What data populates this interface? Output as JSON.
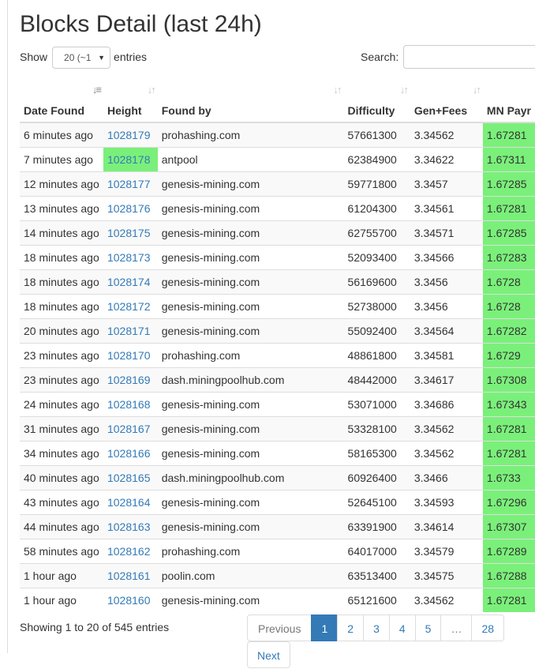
{
  "title": "Blocks Detail (last 24h)",
  "length": {
    "show_label": "Show",
    "selected": "20 (~1",
    "entries_label": "entries"
  },
  "search": {
    "label": "Search:",
    "value": ""
  },
  "columns": [
    "Date Found",
    "Height",
    "Found by",
    "Difficulty",
    "Gen+Fees",
    "MN Payr"
  ],
  "highlight_color": "#7af07a",
  "link_color": "#337ab7",
  "rows": [
    {
      "date": "6 minutes ago",
      "height": "1028179",
      "found_by": "prohashing.com",
      "difficulty": "57661300",
      "gen_fees": "3.34562",
      "mn": "1.67281",
      "height_highlight": false
    },
    {
      "date": "7 minutes ago",
      "height": "1028178",
      "found_by": "antpool",
      "difficulty": "62384900",
      "gen_fees": "3.34622",
      "mn": "1.67311",
      "height_highlight": true
    },
    {
      "date": "12 minutes ago",
      "height": "1028177",
      "found_by": "genesis-mining.com",
      "difficulty": "59771800",
      "gen_fees": "3.3457",
      "mn": "1.67285",
      "height_highlight": false
    },
    {
      "date": "13 minutes ago",
      "height": "1028176",
      "found_by": "genesis-mining.com",
      "difficulty": "61204300",
      "gen_fees": "3.34561",
      "mn": "1.67281",
      "height_highlight": false
    },
    {
      "date": "14 minutes ago",
      "height": "1028175",
      "found_by": "genesis-mining.com",
      "difficulty": "62755700",
      "gen_fees": "3.34571",
      "mn": "1.67285",
      "height_highlight": false
    },
    {
      "date": "18 minutes ago",
      "height": "1028173",
      "found_by": "genesis-mining.com",
      "difficulty": "52093400",
      "gen_fees": "3.34566",
      "mn": "1.67283",
      "height_highlight": false
    },
    {
      "date": "18 minutes ago",
      "height": "1028174",
      "found_by": "genesis-mining.com",
      "difficulty": "56169600",
      "gen_fees": "3.3456",
      "mn": "1.6728",
      "height_highlight": false
    },
    {
      "date": "18 minutes ago",
      "height": "1028172",
      "found_by": "genesis-mining.com",
      "difficulty": "52738000",
      "gen_fees": "3.3456",
      "mn": "1.6728",
      "height_highlight": false
    },
    {
      "date": "20 minutes ago",
      "height": "1028171",
      "found_by": "genesis-mining.com",
      "difficulty": "55092400",
      "gen_fees": "3.34564",
      "mn": "1.67282",
      "height_highlight": false
    },
    {
      "date": "23 minutes ago",
      "height": "1028170",
      "found_by": "prohashing.com",
      "difficulty": "48861800",
      "gen_fees": "3.34581",
      "mn": "1.6729",
      "height_highlight": false
    },
    {
      "date": "23 minutes ago",
      "height": "1028169",
      "found_by": "dash.miningpoolhub.com",
      "difficulty": "48442000",
      "gen_fees": "3.34617",
      "mn": "1.67308",
      "height_highlight": false
    },
    {
      "date": "24 minutes ago",
      "height": "1028168",
      "found_by": "genesis-mining.com",
      "difficulty": "53071000",
      "gen_fees": "3.34686",
      "mn": "1.67343",
      "height_highlight": false
    },
    {
      "date": "31 minutes ago",
      "height": "1028167",
      "found_by": "genesis-mining.com",
      "difficulty": "53328100",
      "gen_fees": "3.34562",
      "mn": "1.67281",
      "height_highlight": false
    },
    {
      "date": "34 minutes ago",
      "height": "1028166",
      "found_by": "genesis-mining.com",
      "difficulty": "58165300",
      "gen_fees": "3.34562",
      "mn": "1.67281",
      "height_highlight": false
    },
    {
      "date": "40 minutes ago",
      "height": "1028165",
      "found_by": "dash.miningpoolhub.com",
      "difficulty": "60926400",
      "gen_fees": "3.3466",
      "mn": "1.6733",
      "height_highlight": false
    },
    {
      "date": "43 minutes ago",
      "height": "1028164",
      "found_by": "genesis-mining.com",
      "difficulty": "52645100",
      "gen_fees": "3.34593",
      "mn": "1.67296",
      "height_highlight": false
    },
    {
      "date": "44 minutes ago",
      "height": "1028163",
      "found_by": "genesis-mining.com",
      "difficulty": "63391900",
      "gen_fees": "3.34614",
      "mn": "1.67307",
      "height_highlight": false
    },
    {
      "date": "58 minutes ago",
      "height": "1028162",
      "found_by": "prohashing.com",
      "difficulty": "64017000",
      "gen_fees": "3.34579",
      "mn": "1.67289",
      "height_highlight": false
    },
    {
      "date": "1 hour ago",
      "height": "1028161",
      "found_by": "poolin.com",
      "difficulty": "63513400",
      "gen_fees": "3.34575",
      "mn": "1.67288",
      "height_highlight": false
    },
    {
      "date": "1 hour ago",
      "height": "1028160",
      "found_by": "genesis-mining.com",
      "difficulty": "65121600",
      "gen_fees": "3.34562",
      "mn": "1.67281",
      "height_highlight": false
    }
  ],
  "info": "Showing 1 to 20 of 545 entries",
  "pagination": {
    "previous": "Previous",
    "pages": [
      "1",
      "2",
      "3",
      "4",
      "5",
      "…",
      "28"
    ],
    "active": "1",
    "next": "Next"
  }
}
